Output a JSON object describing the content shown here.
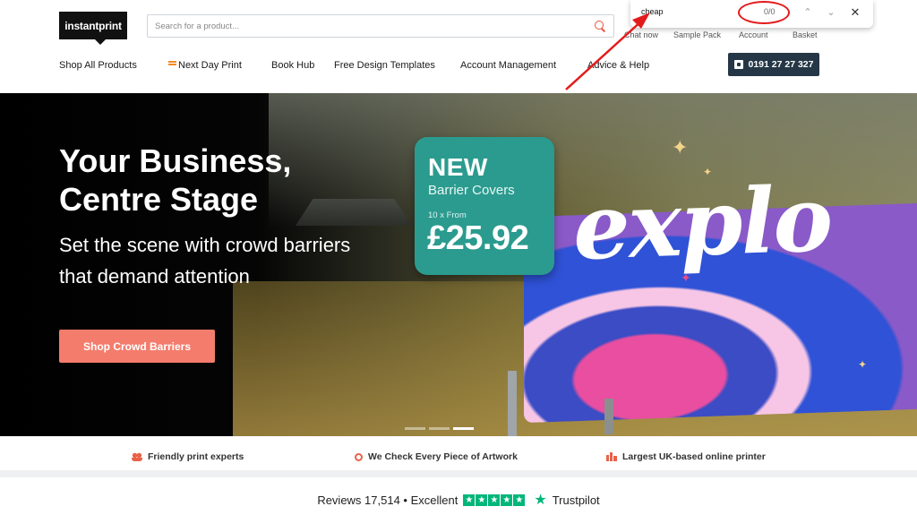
{
  "logo": "instantprint",
  "search": {
    "placeholder": "Search for a product..."
  },
  "util_links": [
    "Chat now",
    "Sample Pack",
    "Account",
    "Basket"
  ],
  "nav": [
    "Shop All Products",
    "Next Day Print",
    "Book Hub",
    "Free Design Templates",
    "Account Management",
    "Advice & Help"
  ],
  "phone": "0191 27 27 327",
  "findbar": {
    "query": "cheap",
    "count": "0/0",
    "up": "^",
    "down": "v",
    "close": "✕"
  },
  "hero": {
    "title": "Your Business, Centre Stage",
    "subtitle": "Set the scene with crowd barriers that demand attention",
    "cta": "Shop Crowd Barriers",
    "banner_word": "explo"
  },
  "promo": {
    "new": "NEW",
    "product": "Barrier Covers",
    "from": "10 x From",
    "price": "£25.92"
  },
  "usps": [
    "Friendly print experts",
    "We Check Every Piece of Artwork",
    "Largest UK-based online printer"
  ],
  "reviews": {
    "text": "Reviews 17,514 • Excellent",
    "brand": "Trustpilot",
    "star": "★"
  },
  "colors": {
    "accent": "#f47c6c",
    "phone_bg": "#253746",
    "promo_bg": "#2b9b8f",
    "annotation": "#e31b1b",
    "trustpilot": "#00b67a"
  }
}
